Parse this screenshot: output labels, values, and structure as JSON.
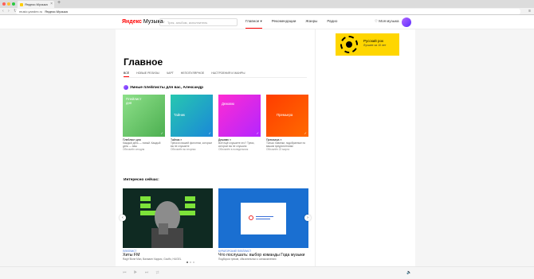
{
  "browser": {
    "tab_title": "Яндекс.Музыка",
    "url_host": "music.yandex.ru",
    "url_page": "Яндекс.Музыка"
  },
  "header": {
    "logo_ya": "Яндекс",
    "logo_rest": "Музыка",
    "search_placeholder": "Трек, альбом, исполнитель",
    "nav": [
      "Главное",
      "Рекомендации",
      "Жанры",
      "Радио"
    ],
    "nav_active_suffix": "▾",
    "my_music": "Моя музыка"
  },
  "main": {
    "title": "Главное",
    "subtabs": [
      "Всё",
      "Новые релизы",
      "Чарт",
      "Непопулярное",
      "Настроения и жанры"
    ],
    "smart_title": "Умные плейлисты для вас, Александр",
    "playlists": [
      {
        "cover_text": "Плейлист дня",
        "title": "Плейлист дня",
        "desc": "Каждый день — новый. Каждый день — ваш",
        "updated": "Обновлён сегодня",
        "color": "#4caf50",
        "color2": "#8ee08a"
      },
      {
        "cover_text": "Тайник",
        "title": "Тайник ×",
        "desc": "Треки из вашей фонотеки, которые вы не слушаете",
        "updated": "Обновлён во вторник",
        "color": "#1a88d8",
        "color2": "#27c7b0"
      },
      {
        "cover_text": "Дежавю",
        "title": "Дежавю ×",
        "desc": "Всё ещё слушаете это? Треки, которые вы не слушали",
        "updated": "Обновлён в понедельник",
        "color": "#b326ff",
        "color2": "#ff2bd2"
      },
      {
        "cover_text": "Премьера",
        "title": "Премьера ×",
        "desc": "Только новинки, подобранные по вашим предпочтениям",
        "updated": "Обновлён 22 марта",
        "color": "#ff6a00",
        "color2": "#ff3d00"
      }
    ],
    "now_title": "Интересно сейчас:",
    "featured": [
      {
        "kicker": "Плейлист",
        "title": "Хиты FM",
        "desc": "Rag'n'Bone Man, Вальвин Харрис, Gouffo, HUGEL"
      },
      {
        "kicker": "Кураторский плейлист",
        "title": "Что послушать: выбор команды Года музыки",
        "desc": "Подборка треков, обязательных к ознакомлению"
      }
    ]
  },
  "ad": {
    "title": "Русский рок",
    "sub": "Лучшее за 10 лет"
  },
  "player": {
    "controls": "⏮ ▶ ⏭ ⇄",
    "volume": "🔈"
  }
}
